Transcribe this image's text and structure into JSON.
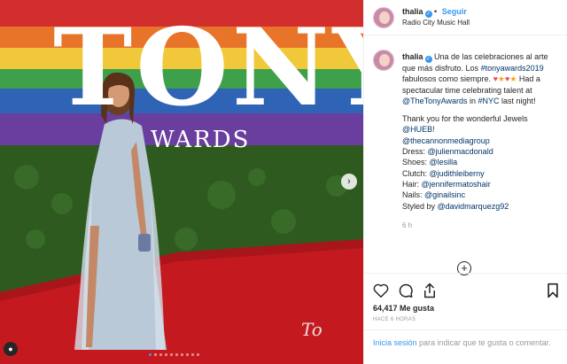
{
  "header": {
    "username": "thalia",
    "follow_label": "Seguir",
    "location": "Radio City Music Hall"
  },
  "caption": {
    "username": "thalia",
    "line1": "Una de las celebraciones al arte que más disfruto. Los",
    "hashtag1": "#tonyawards2019",
    "line2": " fabulosos como siempre.",
    "line3": " Had a spectacular time celebrating talent at",
    "mention_tony": "@TheTonyAwards",
    "line4": " in ",
    "hashtag_nyc": "#NYC",
    "line5": " last night!",
    "thanks": "Thank you for the wonderful Jewels",
    "mention_hueb": "@HUEB!",
    "mention_cannon": "@thecannonmediagroup",
    "dress_label": "Dress: ",
    "dress_mention": "@julienmacdonald",
    "shoes_label": "Shoes: ",
    "shoes_mention": "@lesilla",
    "clutch_label": "Clutch: ",
    "clutch_mention": "@judithleiberny",
    "hair_label": "Hair: ",
    "hair_mention": "@jennifermatoshair",
    "nails_label": "Nails: ",
    "nails_mention": "@ginailsinc",
    "styled_label": "Styled by ",
    "styled_mention": "@davidmarquezg92",
    "time": "6 h"
  },
  "photo": {
    "sign_top": "TONY",
    "sign_bottom": "WARDS",
    "signature": "To",
    "dot_count": 10,
    "active_dot": 0
  },
  "icons": {
    "like": "heart-icon",
    "comment": "comment-icon",
    "share": "share-icon",
    "save": "bookmark-icon",
    "next": "chevron-right-icon",
    "add": "plus-circle-icon"
  },
  "stats": {
    "likes": "64,417 Me gusta",
    "posted": "HACE 6 HORAS"
  },
  "login": {
    "link": "Inicia sesión",
    "text": " para indicar que te gusta o comentar."
  },
  "colors": {
    "accent": "#3897f0",
    "heart": "#ed4956",
    "carpet": "#c41a1f"
  }
}
